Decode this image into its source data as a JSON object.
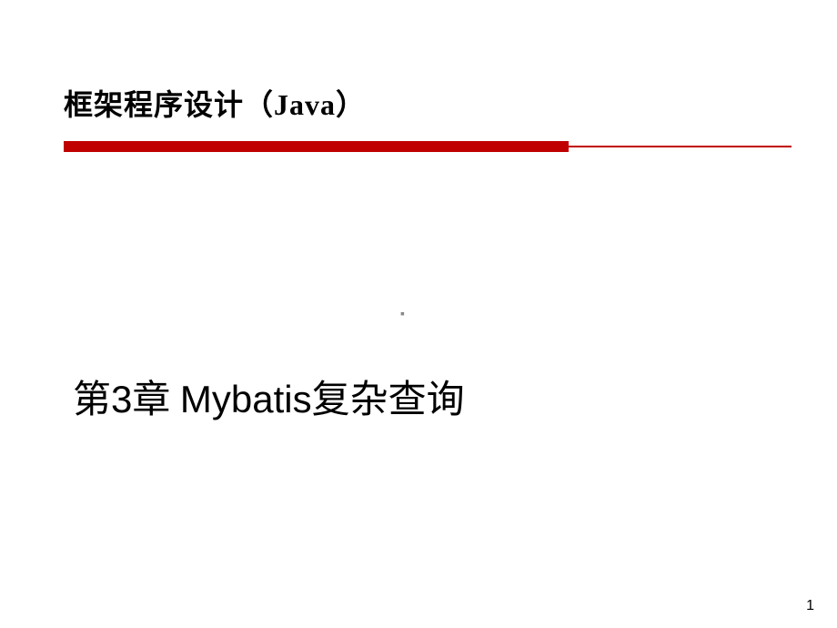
{
  "header": {
    "title": "框架程序设计（Java）"
  },
  "centerMark": "▪",
  "chapter": {
    "prefix": "第",
    "number": "3",
    "suffix": "章 ",
    "name_eng": "Mybatis",
    "name_chn": "复杂查询"
  },
  "pageNumber": "1"
}
